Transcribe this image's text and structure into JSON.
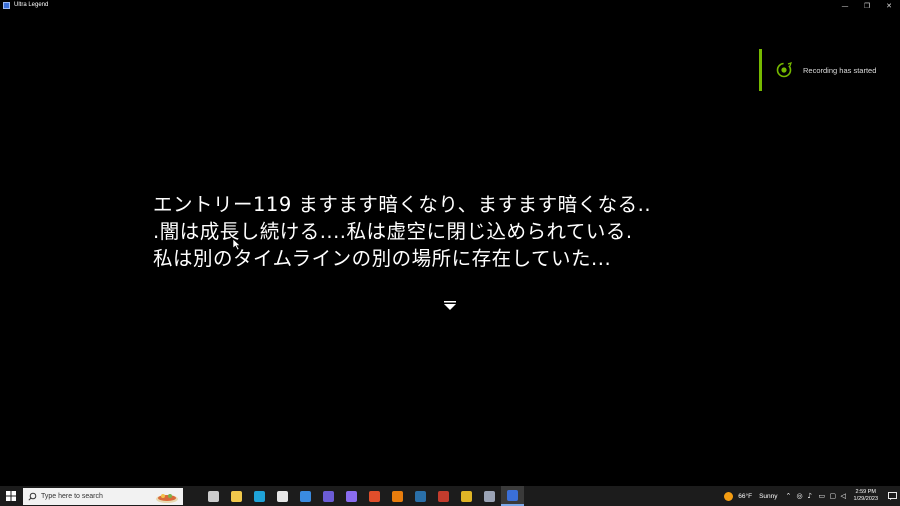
{
  "window": {
    "title": "Ultra Legend",
    "controls": {
      "minimize": "—",
      "restore": "❐",
      "close": "✕"
    }
  },
  "notification": {
    "text": "Recording has started",
    "accent_color": "#76b900"
  },
  "dialogue": {
    "lines": [
      "エントリー119 ますます暗くなり、ますます暗くなる..",
      ".闇は成長し続ける....私は虚空に閉じ込められている.",
      "私は別のタイムラインの別の場所に存在していた..."
    ],
    "advance_icon": "triangle-down-icon"
  },
  "taskbar": {
    "search_placeholder": "Type here to search",
    "pinned": [
      {
        "name": "task-view-icon",
        "color": "#cccccc"
      },
      {
        "name": "file-explorer-icon",
        "color": "#f2c94c"
      },
      {
        "name": "edge-icon",
        "color": "#1fa3d8"
      },
      {
        "name": "store-icon",
        "color": "#e6e6e6"
      },
      {
        "name": "mail-icon",
        "color": "#3a8be0"
      },
      {
        "name": "app-purple-icon",
        "color": "#6b5cd6"
      },
      {
        "name": "app-chat-icon",
        "color": "#8a6cf0"
      },
      {
        "name": "app-orange-icon",
        "color": "#e04e2b"
      },
      {
        "name": "blender-icon",
        "color": "#e87d0d"
      },
      {
        "name": "steam-icon",
        "color": "#2a6fa8"
      },
      {
        "name": "app-red-icon",
        "color": "#c43c2d"
      },
      {
        "name": "chrome-icon",
        "color": "#e0b526"
      },
      {
        "name": "app-ship-icon",
        "color": "#9aa3b5"
      },
      {
        "name": "ultra-legend-icon",
        "color": "#3a6fd8",
        "active": true
      }
    ],
    "weather": {
      "temp": "66°F",
      "condition": "Sunny"
    },
    "clock": {
      "time": "2:59 PM",
      "date": "1/29/2023"
    }
  }
}
